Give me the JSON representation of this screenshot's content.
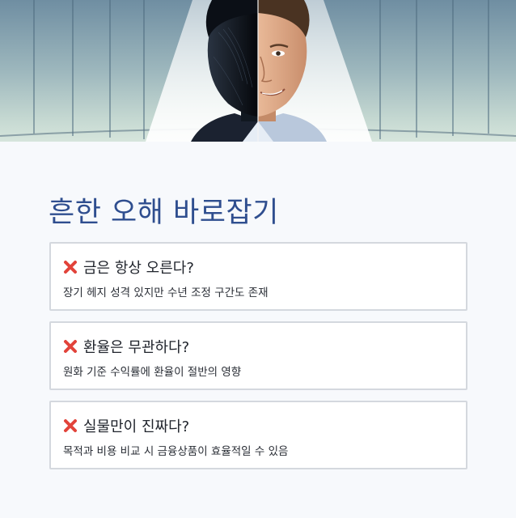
{
  "hero": {
    "image": "split-face-portrait-illustration"
  },
  "title": "흔한 오해 바로잡기",
  "cards": [
    {
      "icon": "cross-mark-icon",
      "heading": "금은 항상 오른다?",
      "description": "장기 헤지 성격 있지만 수년 조정 구간도 존재"
    },
    {
      "icon": "cross-mark-icon",
      "heading": "환율은 무관하다?",
      "description": "원화 기준 수익률에 환율이 절반의 영향"
    },
    {
      "icon": "cross-mark-icon",
      "heading": "실물만이 진짜다?",
      "description": "목적과 비용 비교 시 금융상품이 효율적일 수 있음"
    }
  ],
  "colors": {
    "title": "#2f4e8f",
    "icon": "#e2433a",
    "card_border": "#d4d8de",
    "background": "#f7f9fc"
  }
}
